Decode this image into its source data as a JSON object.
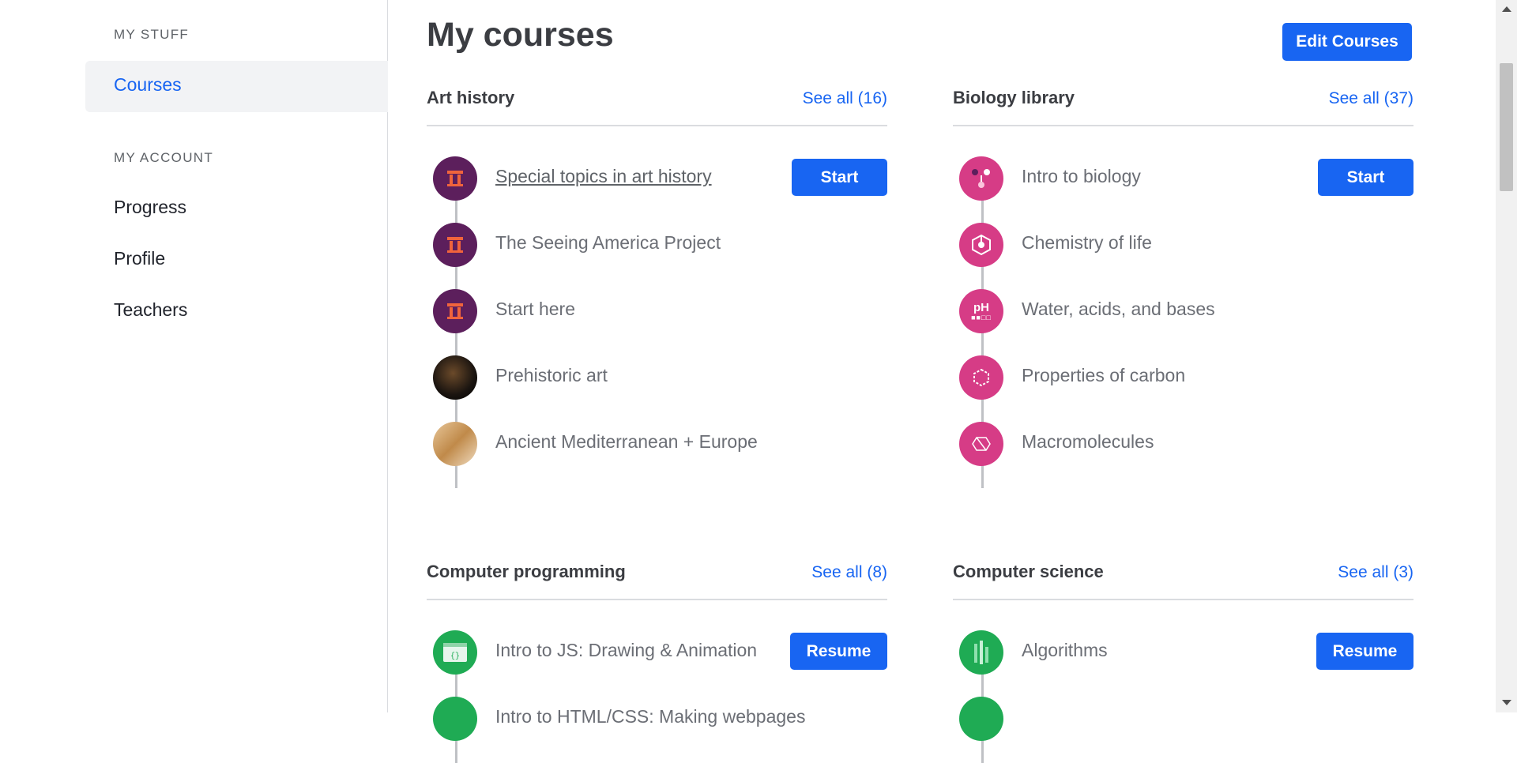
{
  "sidebar": {
    "my_stuff": "MY STUFF",
    "courses": "Courses",
    "my_account": "MY ACCOUNT",
    "progress": "Progress",
    "profile": "Profile",
    "teachers": "Teachers"
  },
  "main": {
    "title": "My courses",
    "edit_courses": "Edit Courses",
    "panels": [
      {
        "title": "Art history",
        "see_all": "See all (16)",
        "action": "Start",
        "courses": [
          {
            "name": "Special topics in art history",
            "icon": "pillar-icon"
          },
          {
            "name": "The Seeing America Project",
            "icon": "pillar-icon"
          },
          {
            "name": "Start here",
            "icon": "pillar-icon"
          },
          {
            "name": "Prehistoric art",
            "icon": "prehistoric-art-thumbnail"
          },
          {
            "name": "Ancient Mediterranean + Europe",
            "icon": "ancient-art-thumbnail"
          }
        ]
      },
      {
        "title": "Biology library",
        "see_all": "See all (37)",
        "action": "Start",
        "courses": [
          {
            "name": "Intro to biology",
            "icon": "flower-icon"
          },
          {
            "name": "Chemistry of life",
            "icon": "molecule-icon"
          },
          {
            "name": "Water, acids, and bases",
            "icon": "ph-icon"
          },
          {
            "name": "Properties of carbon",
            "icon": "carbon-ring-icon"
          },
          {
            "name": "Macromolecules",
            "icon": "macromolecule-icon"
          }
        ]
      },
      {
        "title": "Computer programming",
        "see_all": "See all (8)",
        "action": "Resume",
        "courses": [
          {
            "name": "Intro to JS: Drawing & Animation",
            "icon": "code-window-icon"
          },
          {
            "name": "Intro to HTML/CSS: Making webpages",
            "icon": "code-window-icon"
          }
        ]
      },
      {
        "title": "Computer science",
        "see_all": "See all (3)",
        "action": "Resume",
        "courses": [
          {
            "name": "Algorithms",
            "icon": "algorithm-bars-icon"
          },
          {
            "name": "",
            "icon": "cs-icon"
          }
        ]
      }
    ]
  },
  "colors": {
    "accent": "#1865f2",
    "art_icon_bg": "#5c1f5c",
    "bio_icon_bg": "#d63c86",
    "cs_icon_bg": "#1fab54"
  }
}
